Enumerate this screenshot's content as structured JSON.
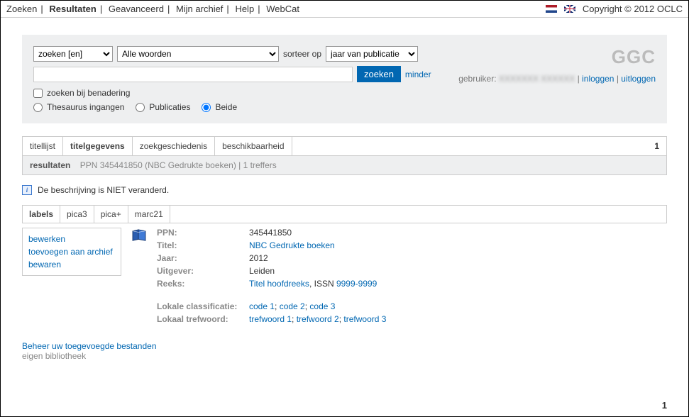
{
  "topnav": {
    "zoeken": "Zoeken",
    "resultaten": "Resultaten",
    "geavanceerd": "Geavanceerd",
    "mijn_archief": "Mijn archief",
    "help": "Help",
    "webcat": "WebCat"
  },
  "top": {
    "copyright": "Copyright © 2012 OCLC"
  },
  "brand": {
    "logo": "GGC"
  },
  "user": {
    "label": "gebruiker:",
    "name": "XXXXXXX XXXXXX",
    "login": "inloggen",
    "logout": "uitloggen"
  },
  "search": {
    "scope": "zoeken [en]",
    "words": "Alle woorden",
    "sort_label": "sorteer op",
    "sort_value": "jaar van publicatie",
    "query": "",
    "button": "zoeken",
    "less": "minder",
    "approx": "zoeken bij benadering",
    "radio1": "Thesaurus ingangen",
    "radio2": "Publicaties",
    "radio3": "Beide"
  },
  "tabs": {
    "t1": "titellijst",
    "t2": "titelgegevens",
    "t3": "zoekgeschiedenis",
    "t4": "beschikbaarheid",
    "count": "1"
  },
  "resultbar": {
    "label": "resultaten",
    "text": "PPN 345441850 (NBC Gedrukte boeken)  |  1 treffers"
  },
  "notice": {
    "text": "De beschrijving is NIET veranderd."
  },
  "formats": {
    "f1": "labels",
    "f2": "pica3",
    "f3": "pica+",
    "f4": "marc21"
  },
  "actions": {
    "a1": "bewerken",
    "a2": "toevoegen aan archief",
    "a3": "bewaren"
  },
  "record": {
    "ppn": {
      "label": "PPN:",
      "value": "345441850"
    },
    "titel": {
      "label": "Titel:",
      "value": "NBC Gedrukte boeken"
    },
    "jaar": {
      "label": "Jaar:",
      "value": "2012"
    },
    "uitgever": {
      "label": "Uitgever:",
      "value": "Leiden"
    },
    "reeks": {
      "label": "Reeks:",
      "value_link": "Titel hoofdreeks",
      "mid": ", ISSN ",
      "issn": "9999-9999"
    },
    "classif": {
      "label": "Lokale classificatie:",
      "v1": "code 1",
      "v2": "code 2",
      "v3": "code 3"
    },
    "trefw": {
      "label": "Lokaal trefwoord:",
      "v1": "trefwoord 1",
      "v2": "trefwoord 2",
      "v3": "trefwoord 3"
    }
  },
  "footer": {
    "beheer": "Beheer uw toegevoegde bestanden",
    "eigen": "eigen bibliotheek"
  },
  "page": {
    "num": "1"
  }
}
